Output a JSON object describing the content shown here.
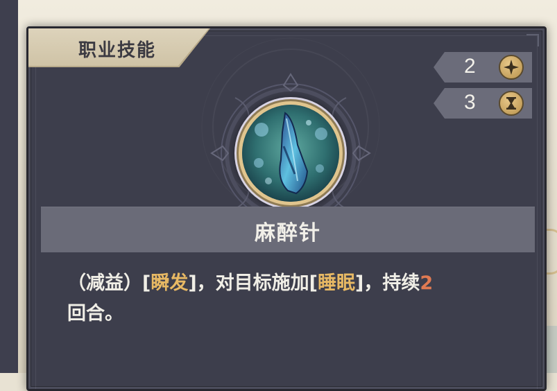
{
  "category_tab": {
    "label": "职业技能"
  },
  "stats": {
    "cost": {
      "value": "2",
      "icon": "star-sparkle-icon"
    },
    "cooldown": {
      "value": "3",
      "icon": "hourglass-icon"
    }
  },
  "skill": {
    "name": "麻醉针",
    "icon": "crystal-needle-icon",
    "description": {
      "part1": "（减益）[",
      "keyword1": "瞬发",
      "part2": "]，对目标施加[",
      "keyword2": "睡眠",
      "part3": "]，持续",
      "duration": "2",
      "part4": "回合。"
    }
  },
  "colors": {
    "card_bg": "#3d3e4c",
    "tab_bg": "#d8cdb2",
    "name_band": "#6a6b78",
    "keyword": "#e8b964",
    "number": "#e07a52",
    "gold": "#c9a867"
  }
}
